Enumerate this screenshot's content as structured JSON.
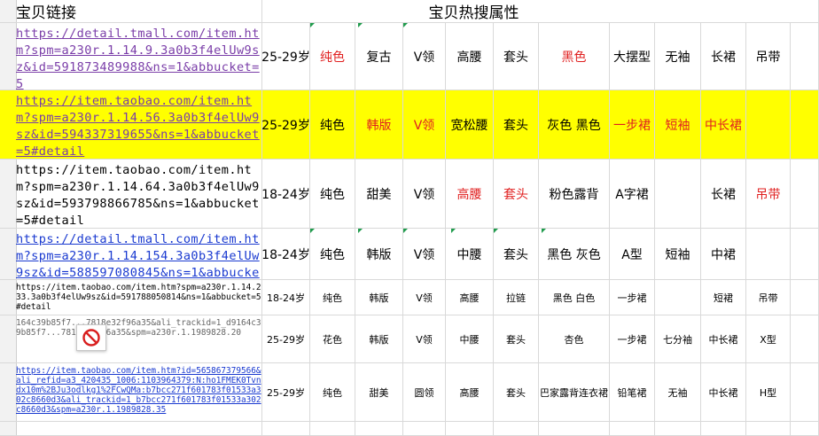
{
  "header": {
    "col_link": "宝贝链接",
    "col_attrs": "宝贝热搜属性"
  },
  "rows": [
    {
      "link": "https://detail.tmall.com/item.htm?spm=a230r.1.14.9.3a0b3f4elUw9sz&id=591873489988&ns=1&abbucket=5",
      "cells": [
        "25-29岁",
        "纯色",
        "复古",
        "V领",
        "高腰",
        "套头",
        "黑色",
        "大摆型",
        "无袖",
        "长裙",
        "吊带"
      ]
    },
    {
      "link": "https://item.taobao.com/item.htm?spm=a230r.1.14.56.3a0b3f4elUw9sz&id=594337319655&ns=1&abbucket=5#detail",
      "cells": [
        "25-29岁",
        "纯色",
        "韩版",
        "V领",
        "宽松腰",
        "套头",
        "灰色 黑色",
        "一步裙",
        "短袖",
        "中长裙",
        ""
      ]
    },
    {
      "link": "https://item.taobao.com/item.htm?spm=a230r.1.14.64.3a0b3f4elUw9sz&id=593798866785&ns=1&abbucket=5#detail",
      "cells": [
        "18-24岁",
        "纯色",
        "甜美",
        "V领",
        "高腰",
        "套头",
        "粉色露背",
        "A字裙",
        "",
        "长裙",
        "吊带"
      ]
    },
    {
      "link": "https://detail.tmall.com/item.htm?spm=a230r.1.14.154.3a0b3f4elUw9sz&id=588597080845&ns=1&abbucket=5",
      "cells": [
        "18-24岁",
        "纯色",
        "韩版",
        "V领",
        "中腰",
        "套头",
        "黑色 灰色",
        "A型",
        "短袖",
        "中裙",
        ""
      ]
    },
    {
      "link": "https://item.taobao.com/item.htm?spm=a230r.1.14.233.3a0b3f4elUw9sz&id=591788050814&ns=1&abbucket=5#detail",
      "cells": [
        "18-24岁",
        "纯色",
        "韩版",
        "V领",
        "高腰",
        "拉链",
        "黑色 白色",
        "一步裙",
        "",
        "短裙",
        "吊带"
      ]
    },
    {
      "link": "164c39b85f7...7818e32f96a35&ali_trackid=1_d9164c39b85f7...7818e32f96a35&spm=a230r.1.1989828.20",
      "cells": [
        "25-29岁",
        "花色",
        "韩版",
        "V领",
        "中腰",
        "套头",
        "杏色",
        "一步裙",
        "七分袖",
        "中长裙",
        "X型"
      ]
    },
    {
      "link": "https://item.taobao.com/item.htm?id=565867379566&ali_refid=a3_420435_1006:1103964379:N:ho1FMEK0Tvndx10m%2BJu3odlkg1%2FCwQMa:b7bcc271f601783f01533a302c8660d3&ali_trackid=1_b7bcc271f601783f01533a302c8660d3&spm=a230r.1.1989828.35",
      "cells": [
        "25-29岁",
        "纯色",
        "甜美",
        "圆领",
        "高腰",
        "套头",
        "巴家露背连衣裙",
        "铅笔裙",
        "无袖",
        "中长裙",
        "H型"
      ]
    }
  ],
  "colors": {
    "highlight": "#ffff00",
    "red_text": "#e02020",
    "link_purple": "#7a3da8",
    "link_blue": "#1a3ad0"
  },
  "icons": {
    "overlay": "no-entry-icon"
  }
}
